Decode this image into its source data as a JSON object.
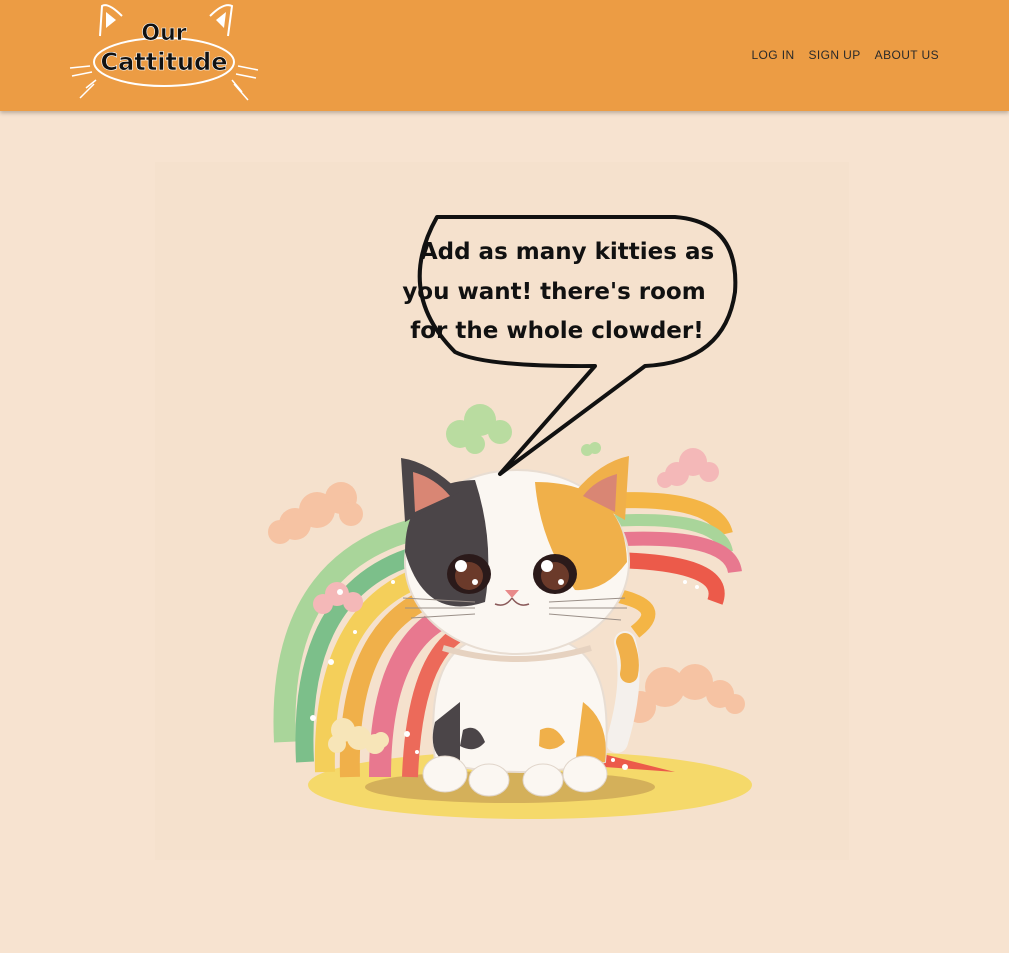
{
  "brand": {
    "logo_line1": "Our",
    "logo_line2": "Cattitude"
  },
  "nav": {
    "items": [
      {
        "label": "LOG IN"
      },
      {
        "label": "SIGN UP"
      },
      {
        "label": "ABOUT US"
      }
    ]
  },
  "hero": {
    "speech_line1": "Add as many kitties as",
    "speech_line2": "you want! there's room",
    "speech_line3": "for the whole clowder!"
  },
  "colors": {
    "header_bg": "#ec9c44",
    "page_bg": "#f7e3d0"
  }
}
